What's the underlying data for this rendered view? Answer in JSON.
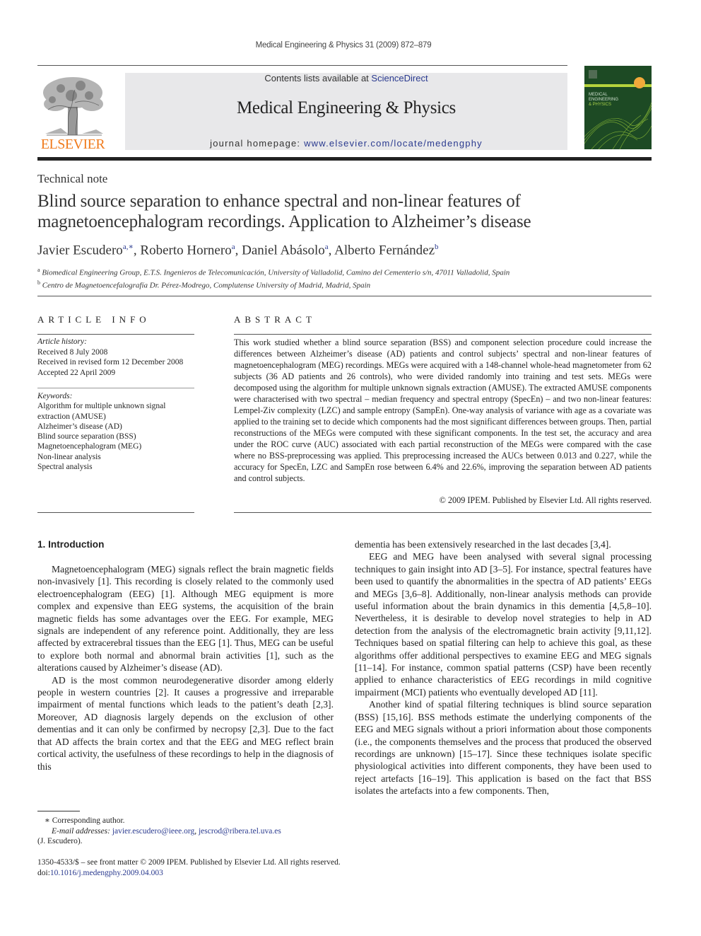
{
  "running_head": "Medical Engineering & Physics 31 (2009) 872–879",
  "masthead": {
    "publisher_logo_text": "ELSEVIER",
    "contents_prefix": "Contents lists available at ",
    "contents_link": "ScienceDirect",
    "journal_title": "Medical Engineering & Physics",
    "homepage_prefix": "journal homepage: ",
    "homepage_link": "www.elsevier.com/locate/medengphy",
    "cover_title_lines": [
      "MEDICAL",
      "ENGINEERING",
      "& PHYSICS"
    ]
  },
  "article": {
    "type": "Technical note",
    "title": "Blind source separation to enhance spectral and non-linear features of magnetoencephalogram recordings. Application to Alzheimer’s disease",
    "authors": [
      {
        "name": "Javier Escudero",
        "sup": "a,∗"
      },
      {
        "name": "Roberto Hornero",
        "sup": "a"
      },
      {
        "name": "Daniel Abásolo",
        "sup": "a"
      },
      {
        "name": "Alberto Fernández",
        "sup": "b"
      }
    ],
    "affiliations": [
      {
        "mark": "a",
        "text": "Biomedical Engineering Group, E.T.S. Ingenieros de Telecomunicación, University of Valladolid, Camino del Cementerio s/n, 47011 Valladolid, Spain"
      },
      {
        "mark": "b",
        "text": "Centro de Magnetoencefalografía Dr. Pérez-Modrego, Complutense University of Madrid, Madrid, Spain"
      }
    ]
  },
  "article_info": {
    "heading": "ARTICLE INFO",
    "history_label": "Article history:",
    "history": [
      "Received 8 July 2008",
      "Received in revised form 12 December 2008",
      "Accepted 22 April 2009"
    ],
    "keywords_label": "Keywords:",
    "keywords": [
      "Algorithm for multiple unknown signal extraction (AMUSE)",
      "Alzheimer’s disease (AD)",
      "Blind source separation (BSS)",
      "Magnetoencephalogram (MEG)",
      "Non-linear analysis",
      "Spectral analysis"
    ]
  },
  "abstract": {
    "heading": "ABSTRACT",
    "text": "This work studied whether a blind source separation (BSS) and component selection procedure could increase the differences between Alzheimer’s disease (AD) patients and control subjects’ spectral and non-linear features of magnetoencephalogram (MEG) recordings. MEGs were acquired with a 148-channel whole-head magnetometer from 62 subjects (36 AD patients and 26 controls), who were divided randomly into training and test sets. MEGs were decomposed using the algorithm for multiple unknown signals extraction (AMUSE). The extracted AMUSE components were characterised with two spectral – median frequency and spectral entropy (SpecEn) – and two non-linear features: Lempel-Ziv complexity (LZC) and sample entropy (SampEn). One-way analysis of variance with age as a covariate was applied to the training set to decide which components had the most significant differences between groups. Then, partial reconstructions of the MEGs were computed with these significant components. In the test set, the accuracy and area under the ROC curve (AUC) associated with each partial reconstruction of the MEGs were compared with the case where no BSS-preprocessing was applied. This preprocessing increased the AUCs between 0.013 and 0.227, while the accuracy for SpecEn, LZC and SampEn rose between 6.4% and 22.6%, improving the separation between AD patients and control subjects.",
    "copyright": "© 2009 IPEM. Published by Elsevier Ltd. All rights reserved."
  },
  "body": {
    "section_heading": "1.  Introduction",
    "left_paragraphs": [
      "Magnetoencephalogram (MEG) signals reflect the brain magnetic fields non-invasively [1]. This recording is closely related to the commonly used electroencephalogram (EEG) [1]. Although MEG equipment is more complex and expensive than EEG systems, the acquisition of the brain magnetic fields has some advantages over the EEG. For example, MEG signals are independent of any reference point. Additionally, they are less affected by extracerebral tissues than the EEG [1]. Thus, MEG can be useful to explore both normal and abnormal brain activities [1], such as the alterations caused by Alzheimer’s disease (AD).",
      "AD is the most common neurodegenerative disorder among elderly people in western countries [2]. It causes a progressive and irreparable impairment of mental functions which leads to the patient’s death [2,3]. Moreover, AD diagnosis largely depends on the exclusion of other dementias and it can only be confirmed by necropsy [2,3]. Due to the fact that AD affects the brain cortex and that the EEG and MEG reflect brain cortical activity, the usefulness of these recordings to help in the diagnosis of this"
    ],
    "right_paragraphs": [
      "dementia has been extensively researched in the last decades [3,4].",
      "EEG and MEG have been analysed with several signal processing techniques to gain insight into AD [3–5]. For instance, spectral features have been used to quantify the abnormalities in the spectra of AD patients’ EEGs and MEGs [3,6–8]. Additionally, non-linear analysis methods can provide useful information about the brain dynamics in this dementia [4,5,8–10]. Nevertheless, it is desirable to develop novel strategies to help in AD detection from the analysis of the electromagnetic brain activity [9,11,12]. Techniques based on spatial filtering can help to achieve this goal, as these algorithms offer additional perspectives to examine EEG and MEG signals [11–14]. For instance, common spatial patterns (CSP) have been recently applied to enhance characteristics of EEG recordings in mild cognitive impairment (MCI) patients who eventually developed AD [11].",
      "Another kind of spatial filtering techniques is blind source separation (BSS) [15,16]. BSS methods estimate the underlying components of the EEG and MEG signals without a priori information about those components (i.e., the components themselves and the process that produced the observed recordings are unknown) [15–17]. Since these techniques isolate specific physiological activities into different components, they have been used to reject artefacts [16–19]. This application is based on the fact that BSS isolates the artefacts into a few components. Then,"
    ]
  },
  "footnotes": {
    "corresponding_mark": "∗",
    "corresponding_text": "Corresponding author.",
    "email_label": "E-mail addresses:",
    "emails": [
      "javier.escudero@ieee.org",
      "jescrod@ribera.tel.uva.es"
    ],
    "email_owner": "(J. Escudero)."
  },
  "front_matter": {
    "issn_line": "1350-4533/$ – see front matter © 2009 IPEM. Published by Elsevier Ltd. All rights reserved.",
    "doi_prefix": "doi:",
    "doi": "10.1016/j.medengphy.2009.04.003"
  },
  "colors": {
    "link": "#2a3a8f",
    "elsevier_orange": "#f07b1d",
    "masthead_bg": "#e8e8ea",
    "cover_green": "#1d4a24"
  }
}
